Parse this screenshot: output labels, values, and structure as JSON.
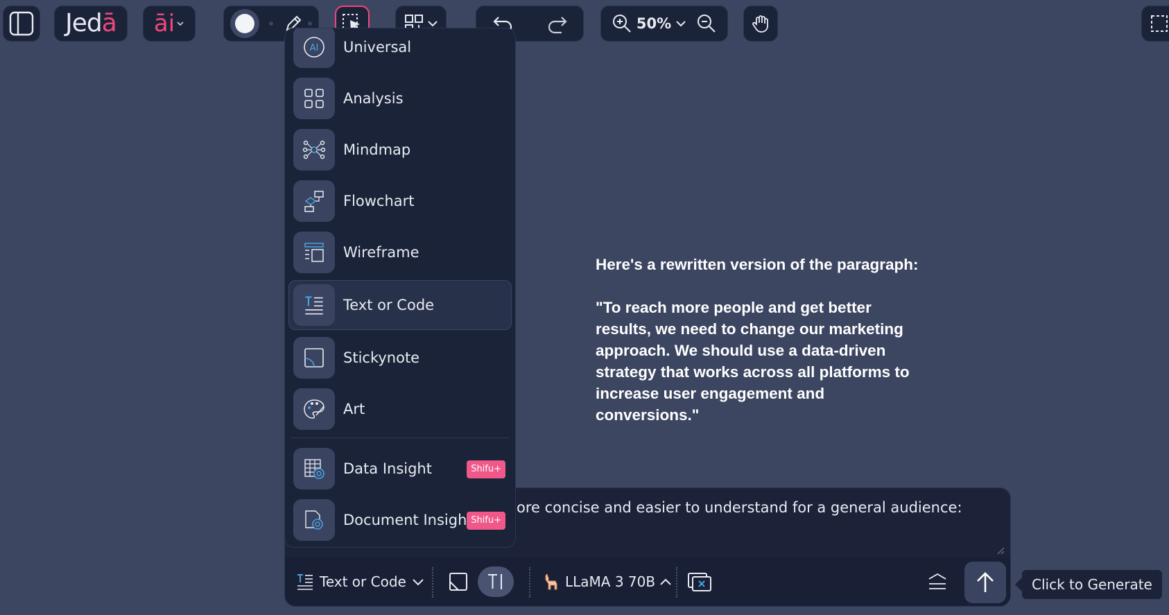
{
  "brand": {
    "logo_main": "Jed",
    "logo_accent": "ā",
    "ai_label": "āi"
  },
  "toolbar": {
    "zoom_value": "50%"
  },
  "menu": {
    "items": [
      {
        "label": "Universal",
        "icon": "ai-icon"
      },
      {
        "label": "Analysis",
        "icon": "grid-icon"
      },
      {
        "label": "Mindmap",
        "icon": "mindmap-icon"
      },
      {
        "label": "Flowchart",
        "icon": "flowchart-icon"
      },
      {
        "label": "Wireframe",
        "icon": "wireframe-icon"
      },
      {
        "label": "Text or Code",
        "icon": "text-code-icon",
        "active": true
      },
      {
        "label": "Stickynote",
        "icon": "stickynote-icon"
      },
      {
        "label": "Art",
        "icon": "palette-icon"
      },
      {
        "label": "Data Insight",
        "icon": "data-insight-icon",
        "badge": "Shifu+"
      },
      {
        "label": "Document Insight",
        "icon": "document-insight-icon",
        "badge": "Shifu+"
      }
    ]
  },
  "canvas": {
    "generated_text": "Here's a rewritten version of the paragraph:\n\n\"To reach more people and get better results, we need to change our marketing approach. We should use a data-driven strategy that works across all platforms to increase user engagement and conversions.\""
  },
  "prompt": {
    "visible_text": "ore concise and easier to understand for a general audience:",
    "mode_label": "Text or Code",
    "model_label": "LLaMA 3 70B",
    "tooltip": "Click to Generate"
  },
  "colors": {
    "accent": "#f0477a",
    "badge": "#f0588a",
    "canvas_bg": "#3c4661",
    "panel_bg": "#1b2338"
  }
}
